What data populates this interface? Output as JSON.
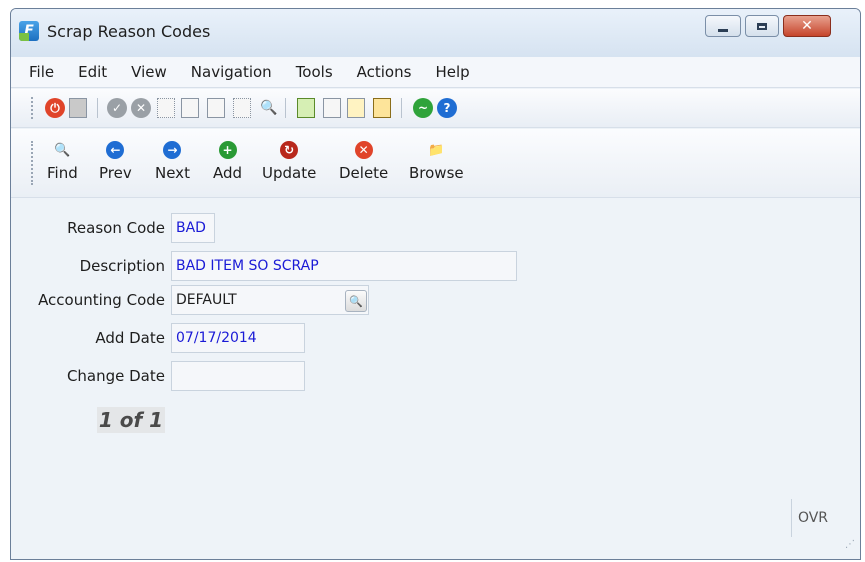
{
  "window": {
    "title": "Scrap Reason Codes",
    "close_glyph": "✕"
  },
  "menu": [
    "File",
    "Edit",
    "View",
    "Navigation",
    "Tools",
    "Actions",
    "Help"
  ],
  "toolbar_icons": {
    "exit": "power-icon",
    "help": "help-icon",
    "zoom": "zoom-icon",
    "help_glyph": "?",
    "zoom_glyph": "🔍"
  },
  "nav": [
    {
      "label": "Find",
      "icon": "find-icon"
    },
    {
      "label": "Prev",
      "icon": "prev-icon"
    },
    {
      "label": "Next",
      "icon": "next-icon"
    },
    {
      "label": "Add",
      "icon": "add-icon"
    },
    {
      "label": "Update",
      "icon": "update-icon"
    },
    {
      "label": "Delete",
      "icon": "delete-icon"
    },
    {
      "label": "Browse",
      "icon": "folder-icon"
    }
  ],
  "nav_glyphs": [
    "🔍",
    "←",
    "→",
    "+",
    "↻",
    "✕",
    "📁"
  ],
  "form": {
    "reason_code_label": "Reason Code",
    "reason_code_value": "BAD",
    "description_label": "Description",
    "description_value": "BAD ITEM SO SCRAP",
    "accounting_code_label": "Accounting Code",
    "accounting_code_value": "DEFAULT",
    "add_date_label": "Add Date",
    "add_date_value": "07/17/2014",
    "change_date_label": "Change Date",
    "change_date_value": "",
    "record_count": "1 of 1"
  },
  "status": {
    "ovr": "OVR"
  },
  "colors": {
    "field_text": "#1a1ad6",
    "window_bg": "#eef3f8"
  }
}
